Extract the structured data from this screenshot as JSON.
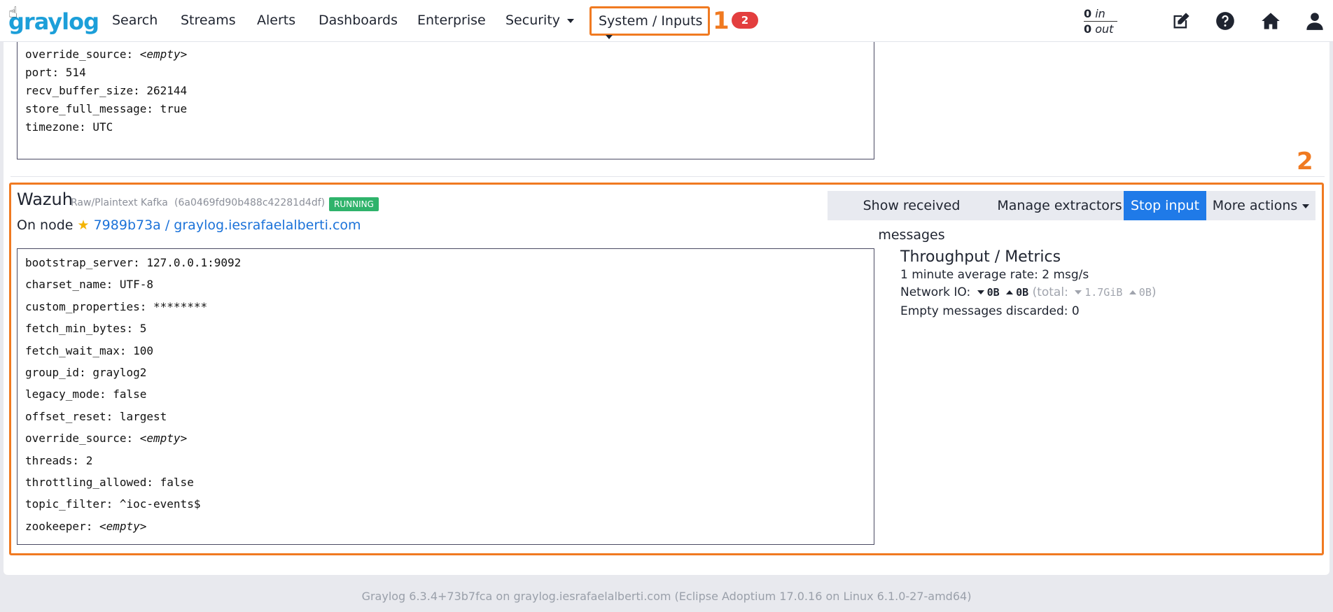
{
  "app": {
    "logo": "graylog"
  },
  "nav": {
    "search": "Search",
    "streams": "Streams",
    "alerts": "Alerts",
    "dashboards": "Dashboards",
    "enterprise": "Enterprise",
    "security": "Security",
    "system": "System / Inputs",
    "notifications_count": "2",
    "throughput_in_value": "0",
    "throughput_in_label": "in",
    "throughput_out_value": "0",
    "throughput_out_label": "out"
  },
  "annotations": {
    "a1": "1",
    "a2": "2"
  },
  "prev_input": {
    "config": [
      {
        "key": "override_source",
        "value": "<empty>",
        "empty": true
      },
      {
        "key": "port",
        "value": "514"
      },
      {
        "key": "recv_buffer_size",
        "value": "262144"
      },
      {
        "key": "store_full_message",
        "value": "true"
      },
      {
        "key": "timezone",
        "value": "UTC"
      }
    ]
  },
  "input": {
    "title": "Wazuh",
    "type": "Raw/Plaintext Kafka",
    "id": "(6a0469fd90b488c42281d4df)",
    "status": "RUNNING",
    "on_node_label": "On node",
    "node": "7989b73a / graylog.iesrafaelalberti.com",
    "actions": {
      "show": "Show received messages",
      "extractors": "Manage extractors",
      "stop": "Stop input",
      "more": "More actions"
    },
    "config": [
      {
        "key": "bootstrap_server",
        "value": "127.0.0.1:9092"
      },
      {
        "key": "charset_name",
        "value": "UTF-8"
      },
      {
        "key": "custom_properties",
        "value": "********"
      },
      {
        "key": "fetch_min_bytes",
        "value": "5"
      },
      {
        "key": "fetch_wait_max",
        "value": "100"
      },
      {
        "key": "group_id",
        "value": "graylog2"
      },
      {
        "key": "legacy_mode",
        "value": "false"
      },
      {
        "key": "offset_reset",
        "value": "largest"
      },
      {
        "key": "override_source",
        "value": "<empty>",
        "empty": true
      },
      {
        "key": "threads",
        "value": "2"
      },
      {
        "key": "throttling_allowed",
        "value": "false"
      },
      {
        "key": "topic_filter",
        "value": "^ioc-events$"
      },
      {
        "key": "zookeeper",
        "value": "<empty>",
        "empty": true
      }
    ],
    "metrics": {
      "title": "Throughput / Metrics",
      "rate": "1 minute average rate: 2 msg/s",
      "network_label": "Network IO:",
      "net_in": "0B",
      "net_out": "0B",
      "total_label": "(total:",
      "total_in": "1.7GiB",
      "total_out": "0B",
      "total_close": ")",
      "discarded": "Empty messages discarded: 0"
    }
  },
  "footer": "Graylog 6.3.4+73b7fca on graylog.iesrafaelalberti.com (Eclipse Adoptium 17.0.16 on Linux 6.1.0-27-amd64)"
}
